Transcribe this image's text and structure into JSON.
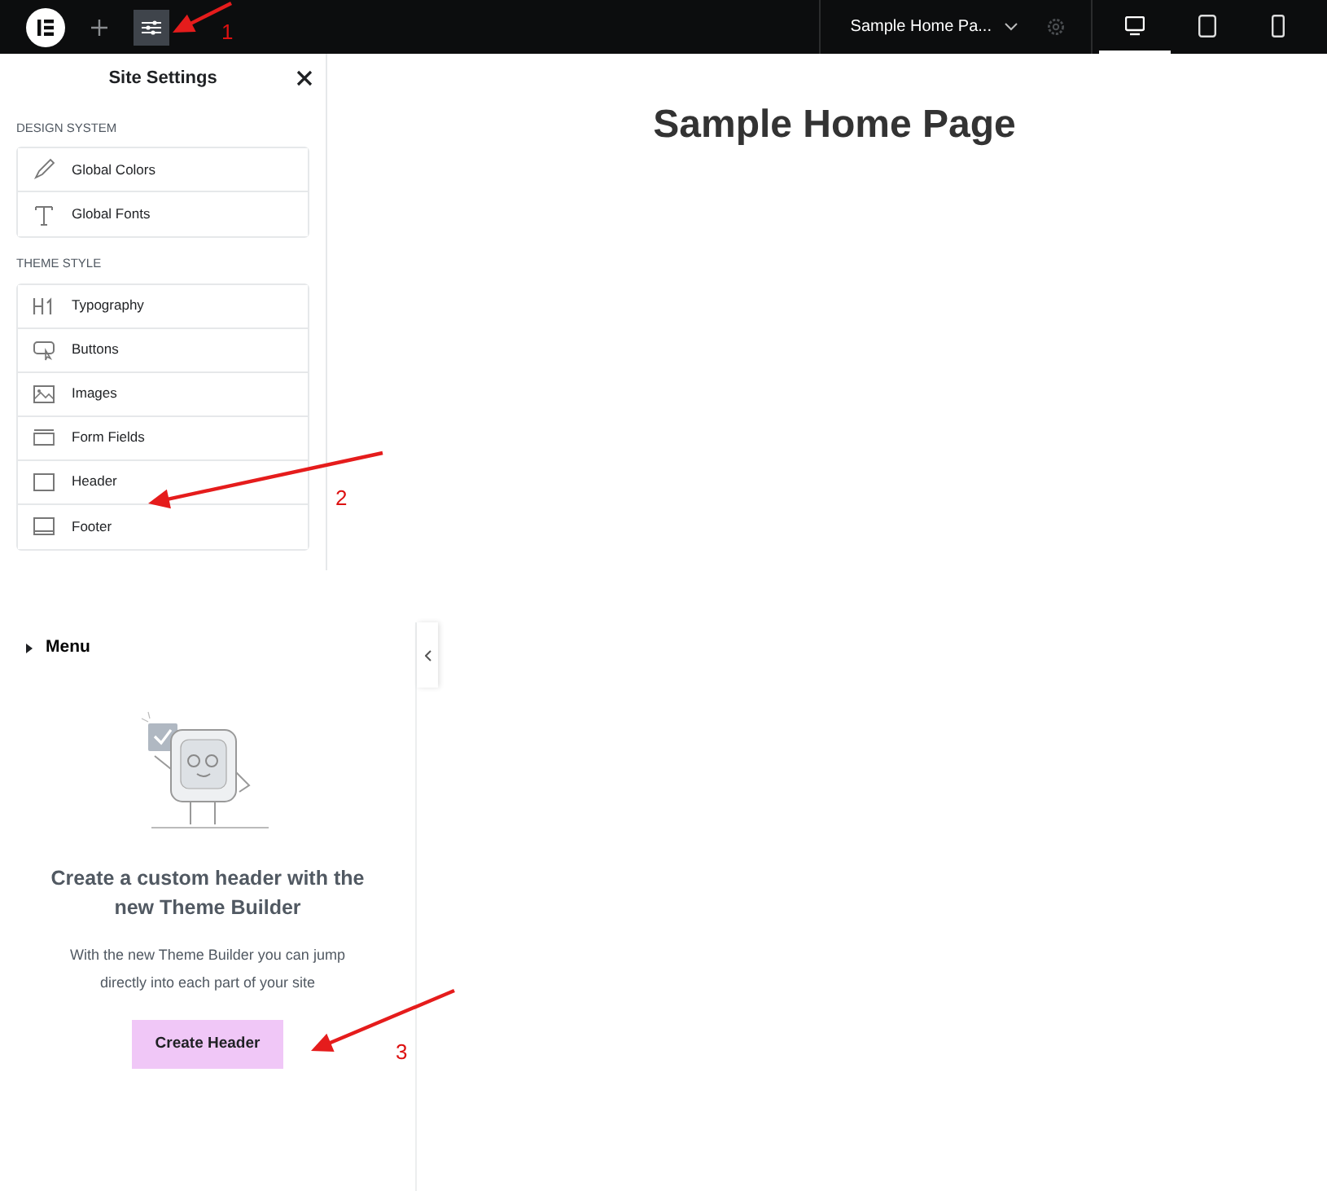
{
  "topbar": {
    "page_title": "Sample Home Pa...",
    "settings_selected": true,
    "devices": [
      {
        "selected": true
      },
      {
        "selected": false
      },
      {
        "selected": false
      }
    ]
  },
  "site_settings": {
    "title": "Site Settings",
    "sections": [
      {
        "heading": "DESIGN SYSTEM",
        "items": [
          "Global Colors",
          "Global Fonts"
        ]
      },
      {
        "heading": "THEME STYLE",
        "items": [
          "Typography",
          "Buttons",
          "Images",
          "Form Fields",
          "Header",
          "Footer"
        ]
      }
    ]
  },
  "menu_panel": {
    "title": "Menu",
    "heading": "Create a custom header with the new Theme Builder",
    "text": "With the new Theme Builder you can jump directly into each part of your site",
    "button": "Create Header"
  },
  "page": {
    "title": "Sample Home Page"
  },
  "annotations": [
    {
      "label": "1"
    },
    {
      "label": "2"
    },
    {
      "label": "3"
    }
  ]
}
